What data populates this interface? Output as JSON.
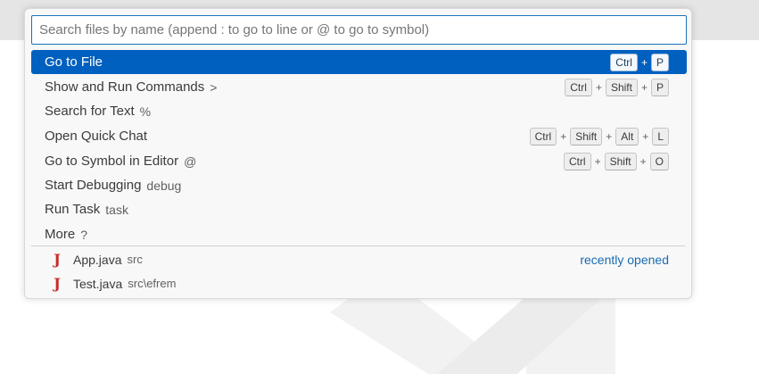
{
  "search": {
    "placeholder": "Search files by name (append : to go to line or @ to go to symbol)"
  },
  "commands": [
    {
      "label": "Go to File",
      "desc": "",
      "keys": [
        "Ctrl",
        "P"
      ]
    },
    {
      "label": "Show and Run Commands",
      "desc": ">",
      "keys": [
        "Ctrl",
        "Shift",
        "P"
      ]
    },
    {
      "label": "Search for Text",
      "desc": "%",
      "keys": []
    },
    {
      "label": "Open Quick Chat",
      "desc": "",
      "keys": [
        "Ctrl",
        "Shift",
        "Alt",
        "L"
      ]
    },
    {
      "label": "Go to Symbol in Editor",
      "desc": "@",
      "keys": [
        "Ctrl",
        "Shift",
        "O"
      ]
    },
    {
      "label": "Start Debugging",
      "desc": "debug",
      "keys": []
    },
    {
      "label": "Run Task",
      "desc": "task",
      "keys": []
    },
    {
      "label": "More",
      "desc": "?",
      "keys": []
    }
  ],
  "files": [
    {
      "name": "App.java",
      "path": "src",
      "badge": "recently opened",
      "icon": "java-file-icon"
    },
    {
      "name": "Test.java",
      "path": "src\\efrem",
      "badge": "",
      "icon": "java-file-icon"
    }
  ],
  "icons": {
    "java_glyph": "J"
  },
  "colors": {
    "selection": "#0060c0",
    "accent_border": "#1a73b8",
    "java_icon": "#c82b27",
    "link": "#1a6bb3"
  },
  "shortcut_joiner": "+"
}
